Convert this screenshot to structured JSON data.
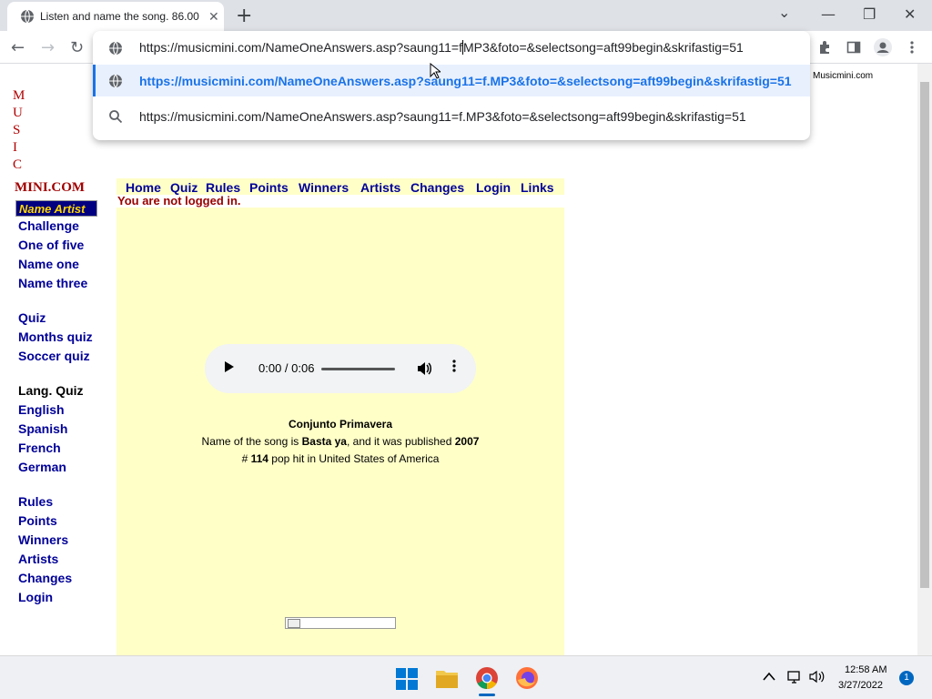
{
  "browser": {
    "tab_title": "Listen and name the song. 86.00",
    "tab_close": "✕",
    "new_tab": "+",
    "window_controls": {
      "minimize": "—",
      "restore": "❐",
      "close": "✕",
      "tabsearch": "⌄"
    },
    "nav": {
      "back": "←",
      "forward": "→",
      "reload": "↻"
    },
    "omnibox": {
      "input_prefix": "https://musicmini.com/NameOneAnswers.asp?saung11=f",
      "input_suffix": "MP3&foto=&selectsong=aft99begin&skrifastig=51",
      "suggestion_url": "https://musicmini.com/NameOneAnswers.asp?saung11=f.MP3&foto=&selectsong=aft99begin&skrifastig=51",
      "suggestion_search": "https://musicmini.com/NameOneAnswers.asp?saung11=f.MP3&foto=&selectsong=aft99begin&skrifastig=51"
    },
    "accent_color": "#1a73e8"
  },
  "site": {
    "logo_letters": [
      "M",
      "U",
      "S",
      "I",
      "C"
    ],
    "logo_mini": "MINI.COM",
    "right_label": "Musicmini.com",
    "badge": "Name Artist",
    "sidebar_group1": [
      "Challenge",
      "One of five",
      "Name one",
      "Name three"
    ],
    "sidebar_group2": [
      "Quiz",
      "Months quiz",
      "Soccer quiz"
    ],
    "sidebar_lang_heading": "Lang. Quiz",
    "sidebar_group3": [
      "English",
      "Spanish",
      "French",
      "German"
    ],
    "sidebar_group4": [
      "Rules",
      "Points",
      "Winners",
      "Artists",
      "Changes",
      "Login"
    ],
    "topnav": [
      "Home",
      "Quiz",
      "Rules",
      "Points",
      "Winners",
      "Artists",
      "Changes",
      "Login",
      "Links"
    ],
    "login_status": "You are not logged in.",
    "audio": {
      "time": "0:00 / 0:06"
    },
    "artist": "Conjunto Primavera",
    "song_line": {
      "prefix": "Name of the song is ",
      "song": "Basta ya",
      "middle": ", and it was published ",
      "year": "2007"
    },
    "rank_line": {
      "prefix": "# ",
      "rank": "114",
      "suffix": " pop hit in United States of America"
    }
  },
  "taskbar": {
    "time": "12:58 AM",
    "date": "3/27/2022",
    "notifications": "1"
  }
}
